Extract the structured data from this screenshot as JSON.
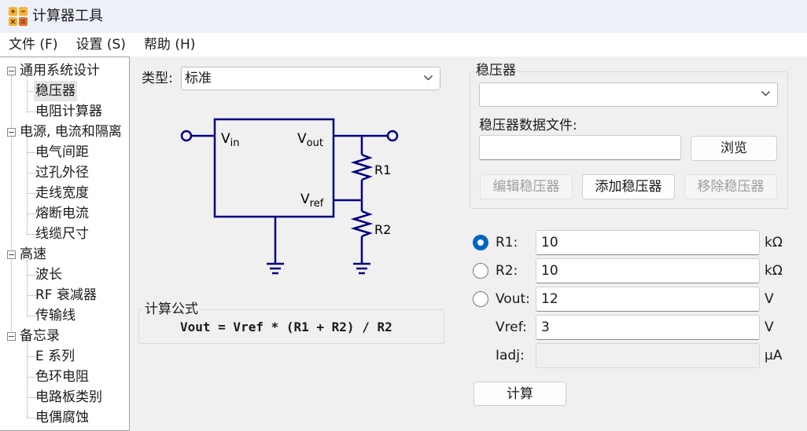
{
  "window": {
    "title": "计算器工具"
  },
  "menu": [
    {
      "label": "文件 (F)"
    },
    {
      "label": "设置 (S)"
    },
    {
      "label": "帮助 (H)"
    }
  ],
  "tree": {
    "groups": [
      {
        "label": "通用系统设计",
        "children": [
          "稳压器",
          "电阻计算器"
        ]
      },
      {
        "label": "电源, 电流和隔离",
        "children": [
          "电气间距",
          "过孔外径",
          "走线宽度",
          "熔断电流",
          "线缆尺寸"
        ]
      },
      {
        "label": "高速",
        "children": [
          "波长",
          "RF 衰减器",
          "传输线"
        ]
      },
      {
        "label": "备忘录",
        "children": [
          "E 系列",
          "色环电阻",
          "电路板类别",
          "电偶腐蚀"
        ]
      }
    ],
    "selected": "稳压器",
    "expander_glyph": "−"
  },
  "type_selector": {
    "label": "类型:",
    "value": "标准"
  },
  "schematic": {
    "vin": "V",
    "vin_sub": "in",
    "vout": "V",
    "vout_sub": "out",
    "vref": "V",
    "vref_sub": "ref",
    "r1": "R1",
    "r2": "R2"
  },
  "formula": {
    "group_label": "计算公式",
    "expression": "Vout = Vref * (R1 + R2) / R2"
  },
  "regulator": {
    "group_label": "稳压器",
    "selected_value": "",
    "data_file_label": "稳压器数据文件:",
    "data_file_value": "",
    "browse_label": "浏览",
    "edit_label": "编辑稳压器",
    "add_label": "添加稳压器",
    "remove_label": "移除稳压器"
  },
  "params": [
    {
      "label": "R1:",
      "value": "10",
      "unit": "kΩ",
      "radio": true,
      "checked": true
    },
    {
      "label": "R2:",
      "value": "10",
      "unit": "kΩ",
      "radio": true,
      "checked": false
    },
    {
      "label": "Vout:",
      "value": "12",
      "unit": "V",
      "radio": true,
      "checked": false
    },
    {
      "label": "Vref:",
      "value": "3",
      "unit": "V",
      "radio": false
    },
    {
      "label": "Iadj:",
      "value": "",
      "unit": "μA",
      "radio": false,
      "disabled": true
    }
  ],
  "calculate_label": "计算",
  "colors": {
    "accent": "#0067c0",
    "circuit": "#000080",
    "titlebar": "#eef0f9"
  }
}
